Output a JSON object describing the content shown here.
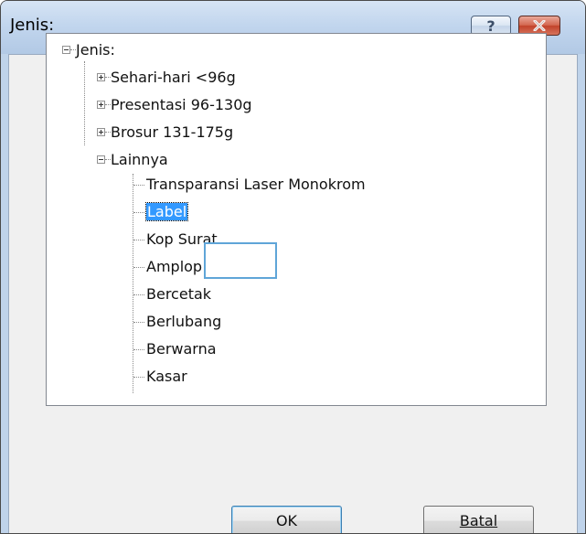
{
  "window": {
    "title": "Jenis:",
    "help_glyph": "?",
    "close_glyph": "✕",
    "close_color": "#c8442b"
  },
  "tree": {
    "root": {
      "label": "Jenis:",
      "state": "expanded"
    },
    "categories": [
      {
        "label": "Sehari-hari <96g",
        "state": "collapsed"
      },
      {
        "label": "Presentasi 96-130g",
        "state": "collapsed"
      },
      {
        "label": "Brosur 131-175g",
        "state": "collapsed"
      },
      {
        "label": "Lainnya",
        "state": "expanded"
      }
    ],
    "other_items": [
      {
        "label": "Transparansi Laser Monokrom"
      },
      {
        "label": "Label",
        "selected": true
      },
      {
        "label": "Kop Surat"
      },
      {
        "label": "Amplop"
      },
      {
        "label": "Bercetak"
      },
      {
        "label": "Berlubang"
      },
      {
        "label": "Berwarna"
      },
      {
        "label": "Kasar"
      }
    ]
  },
  "buttons": {
    "ok": "OK",
    "cancel": "Batal"
  },
  "colors": {
    "selection": "#3399ff",
    "focus_box": "#5fa5d8",
    "titlebar": "#c2d6ee"
  }
}
